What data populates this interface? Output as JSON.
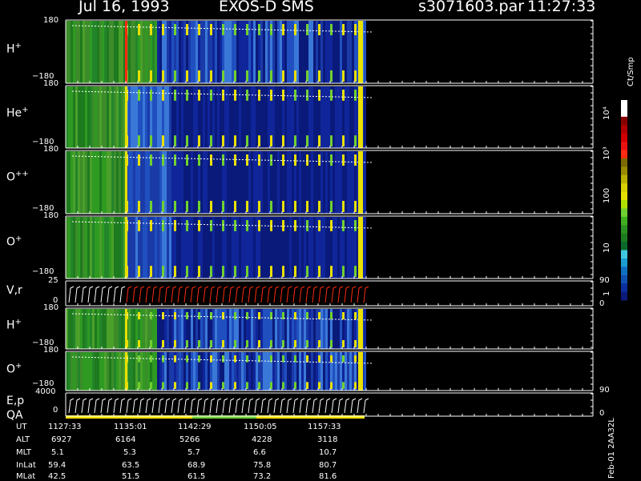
{
  "header": {
    "date": "Jul 16, 1993",
    "instrument": "EXOS-D SMS",
    "file": "s3071603.par",
    "time": "11:27:33"
  },
  "colors": {
    "frame": "#ffffff",
    "background": "#000000",
    "spectrogram_bg": "#0a1a7a",
    "vr_trace": "#ff2a10",
    "qa_bar": "#ffe000"
  },
  "panels": [
    {
      "label": "H",
      "sup": "+",
      "top": "180",
      "bottom": "−180"
    },
    {
      "label": "He",
      "sup": "+",
      "top": "180",
      "bottom": "−180"
    },
    {
      "label": "O",
      "sup": "++",
      "top": "180",
      "bottom": "−180"
    },
    {
      "label": "O",
      "sup": "+",
      "top": "180",
      "bottom": "−180"
    },
    {
      "label": "V,r",
      "sup": "",
      "top": "25",
      "bottom": "0",
      "right_top": "90",
      "right_bottom": "0"
    },
    {
      "label": "H",
      "sup": "+",
      "top": "180",
      "bottom": "−180"
    },
    {
      "label": "O",
      "sup": "+",
      "top": "180",
      "bottom": "−180"
    },
    {
      "label": "E,p",
      "sup": "",
      "label2": "QA",
      "top": "4000",
      "bottom": "0",
      "right_top": "90",
      "right_bottom": "0"
    }
  ],
  "colorbar": {
    "unit": "Ct/Smp",
    "ticks": [
      "10⁴",
      "10³",
      "100",
      "10",
      "1"
    ]
  },
  "footer_label": "Feb-01 2AA32L",
  "ephemeris": {
    "rows": [
      {
        "name": "UT",
        "values": [
          "1127:33",
          "1135:01",
          "1142:29",
          "1150:05",
          "1157:33"
        ]
      },
      {
        "name": "ALT",
        "values": [
          "6927",
          "6164",
          "5266",
          "4228",
          "3118"
        ]
      },
      {
        "name": "MLT",
        "values": [
          "5.1",
          "5.3",
          "5.7",
          "6.6",
          "10.7"
        ]
      },
      {
        "name": "InLat",
        "values": [
          "59.4",
          "63.5",
          "68.9",
          "75.8",
          "80.7"
        ]
      },
      {
        "name": "MLat",
        "values": [
          "42.5",
          "51.5",
          "61.5",
          "73.2",
          "81.6"
        ]
      }
    ]
  },
  "chart_data": {
    "type": "heatmap",
    "title": "Jul 16, 1993   EXOS-D SMS",
    "x": [
      "1127:33",
      "1135:01",
      "1142:29",
      "1150:05",
      "1157:33"
    ],
    "series": [
      {
        "name": "H+",
        "yrange": [
          -180,
          180
        ]
      },
      {
        "name": "He+",
        "yrange": [
          -180,
          180
        ]
      },
      {
        "name": "O++",
        "yrange": [
          -180,
          180
        ]
      },
      {
        "name": "O+",
        "yrange": [
          -180,
          180
        ]
      },
      {
        "name": "V,r",
        "yrange": [
          0,
          25
        ],
        "right_range": [
          0,
          90
        ]
      },
      {
        "name": "H+",
        "yrange": [
          -180,
          180
        ]
      },
      {
        "name": "O+",
        "yrange": [
          -180,
          180
        ]
      },
      {
        "name": "E,p",
        "yrange": [
          0,
          4000
        ],
        "right_range": [
          0,
          90
        ]
      }
    ],
    "colorbar": {
      "label": "Ct/Smp",
      "ticks": [
        "1",
        "10",
        "100",
        "10³",
        "10⁴"
      ]
    }
  }
}
